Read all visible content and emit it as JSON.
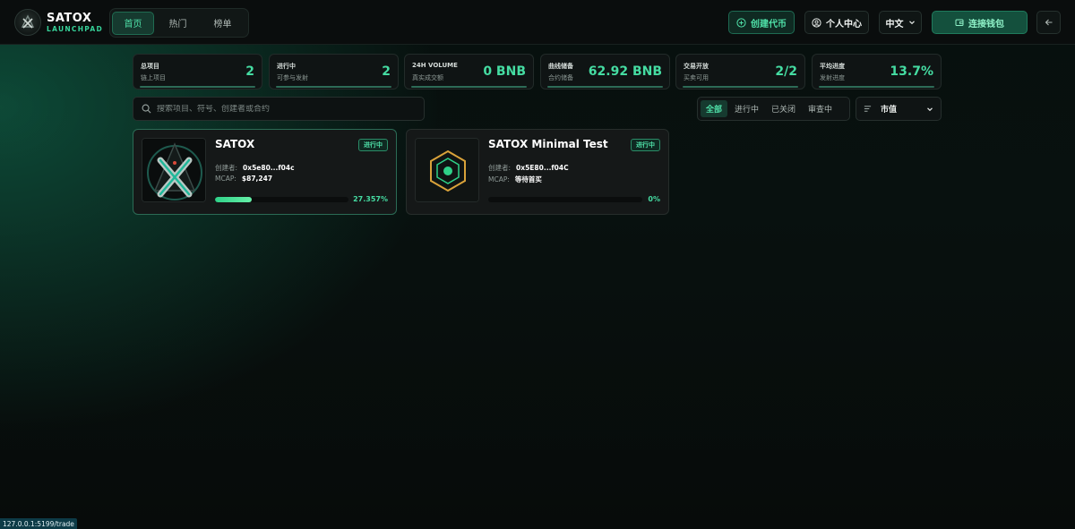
{
  "header": {
    "logo": {
      "title": "SATOX",
      "subtitle": "LAUNCHPAD"
    },
    "nav": [
      {
        "label": "首页",
        "active": true
      },
      {
        "label": "热门",
        "active": false
      },
      {
        "label": "榜单",
        "active": false
      }
    ],
    "create_label": "创建代币",
    "profile_label": "个人中心",
    "language_label": "中文",
    "wallet_label": "连接钱包"
  },
  "stats": [
    {
      "label": "总项目",
      "sub": "链上项目",
      "value": "2"
    },
    {
      "label": "进行中",
      "sub": "可参与发射",
      "value": "2"
    },
    {
      "label": "24H VOLUME",
      "sub": "真实成交额",
      "value": "0 BNB"
    },
    {
      "label": "曲线储备",
      "sub": "合约储备",
      "value": "62.92 BNB"
    },
    {
      "label": "交易开放",
      "sub": "买卖可用",
      "value": "2/2"
    },
    {
      "label": "平均进度",
      "sub": "发射进度",
      "value": "13.7%"
    }
  ],
  "search": {
    "placeholder": "搜索项目、符号、创建者或合约"
  },
  "filters": [
    {
      "label": "全部",
      "active": true
    },
    {
      "label": "进行中",
      "active": false
    },
    {
      "label": "已关闭",
      "active": false
    },
    {
      "label": "审查中",
      "active": false
    }
  ],
  "sort": {
    "label": "市值"
  },
  "cards": [
    {
      "title": "SATOX",
      "status": "进行中",
      "creator_label": "创建者:",
      "creator": "0x5e80...f04c",
      "mcap_label": "MCAP:",
      "mcap": "$87,247",
      "progress": 27.357,
      "progress_text": "27.357%"
    },
    {
      "title": "SATOX Minimal Test",
      "status": "进行中",
      "creator_label": "创建者:",
      "creator": "0x5E80...f04C",
      "mcap_label": "MCAP:",
      "mcap": "等待首买",
      "progress": 0,
      "progress_text": "0%"
    }
  ],
  "statusbar": {
    "url": "127.0.0.1:5199/trade"
  },
  "colors": {
    "accent": "#45dca2",
    "background": "#07100e",
    "card": "#151818"
  }
}
